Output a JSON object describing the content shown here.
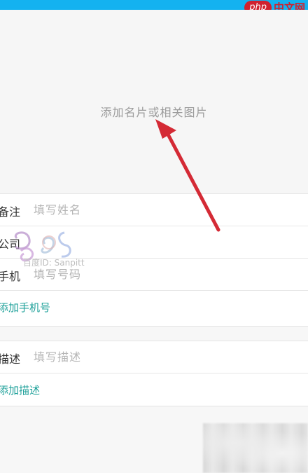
{
  "brand": {
    "badge": "php",
    "site": "中文网"
  },
  "photo": {
    "hint": "添加名片或相关图片"
  },
  "contact_fields": [
    {
      "label": "备注",
      "placeholder": "填写姓名"
    },
    {
      "label": "公司",
      "placeholder": ""
    },
    {
      "label": "手机",
      "placeholder": "填写号码"
    }
  ],
  "add_phone": "添加手机号",
  "description": {
    "label": "描述",
    "placeholder": "填写描述"
  },
  "add_description": "添加描述",
  "watermark": {
    "text": "百度ID: Sanpitt"
  },
  "colors": {
    "status_bar": "#14b2f0",
    "arrow": "#d42a35",
    "link": "#1fa19a"
  }
}
